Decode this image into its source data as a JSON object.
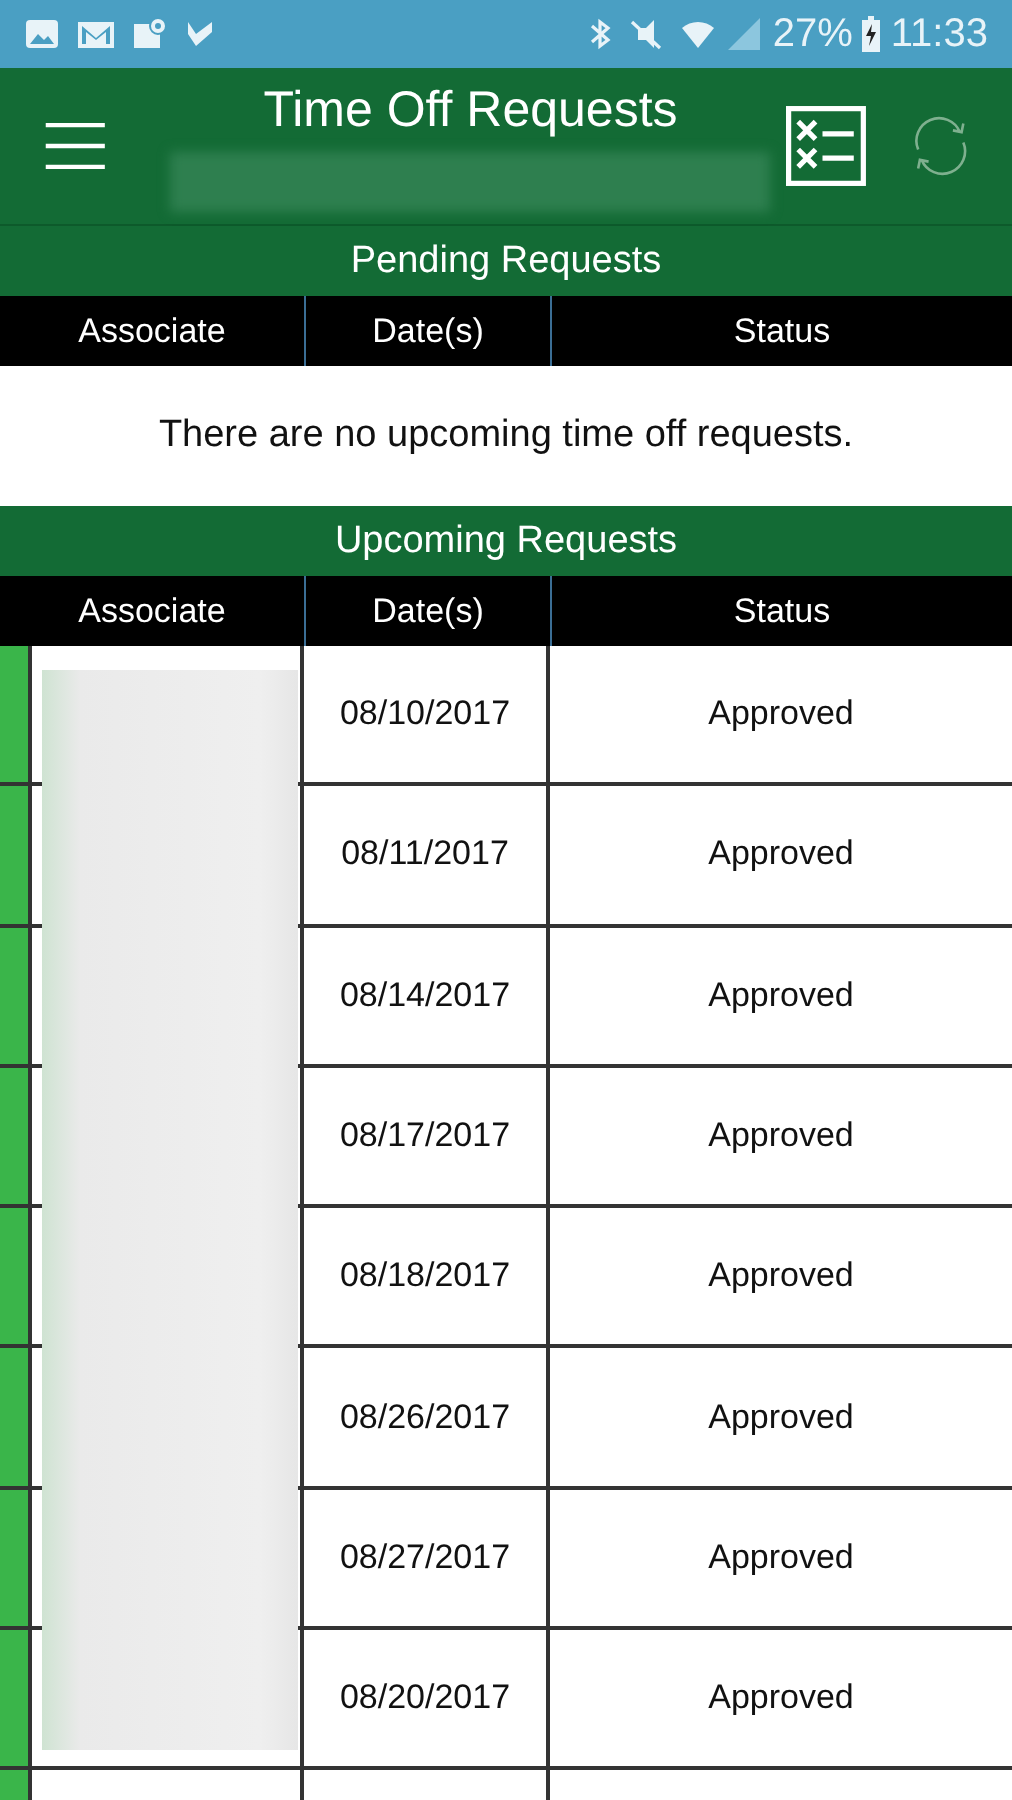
{
  "status_bar": {
    "battery": "27%",
    "time": "11:33"
  },
  "header": {
    "title": "Time Off Requests"
  },
  "pending": {
    "title": "Pending Requests",
    "columns": [
      "Associate",
      "Date(s)",
      "Status"
    ],
    "empty_message": "There are no upcoming time off requests."
  },
  "upcoming": {
    "title": "Upcoming Requests",
    "columns": [
      "Associate",
      "Date(s)",
      "Status"
    ],
    "rows": [
      {
        "date": "08/10/2017",
        "status": "Approved"
      },
      {
        "date": "08/11/2017",
        "status": "Approved"
      },
      {
        "date": "08/14/2017",
        "status": "Approved"
      },
      {
        "date": "08/17/2017",
        "status": "Approved"
      },
      {
        "date": "08/18/2017",
        "status": "Approved"
      },
      {
        "date": "08/26/2017",
        "status": "Approved"
      },
      {
        "date": "08/27/2017",
        "status": "Approved"
      },
      {
        "date": "08/20/2017",
        "status": "Approved"
      }
    ]
  }
}
